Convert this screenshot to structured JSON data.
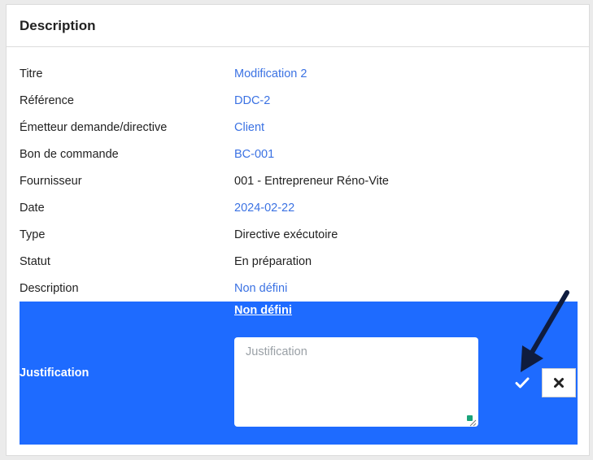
{
  "panel": {
    "title": "Description"
  },
  "fields": [
    {
      "label": "Titre",
      "value": "Modification 2"
    },
    {
      "label": "Référence",
      "value": "DDC-2"
    },
    {
      "label": "Émetteur demande/directive",
      "value": "Client"
    },
    {
      "label": "Bon de commande",
      "value": "BC-001"
    },
    {
      "label": "Fournisseur",
      "value": "001 - Entrepreneur Réno-Vite"
    },
    {
      "label": "Date",
      "value": "2024-02-22"
    },
    {
      "label": "Type",
      "value": "Directive exécutoire"
    },
    {
      "label": "Statut",
      "value": "En préparation"
    },
    {
      "label": "Description",
      "value": "Non défini"
    }
  ],
  "justification": {
    "label": "Justification",
    "current_value_link": "Non défini",
    "input_value": "",
    "placeholder": "Justification",
    "confirm_icon": "check-icon",
    "cancel_icon": "close-icon"
  },
  "colors": {
    "link": "#3b72e3",
    "edit_band": "#1e6bff",
    "annotation_arrow": "#0f1c3f"
  }
}
